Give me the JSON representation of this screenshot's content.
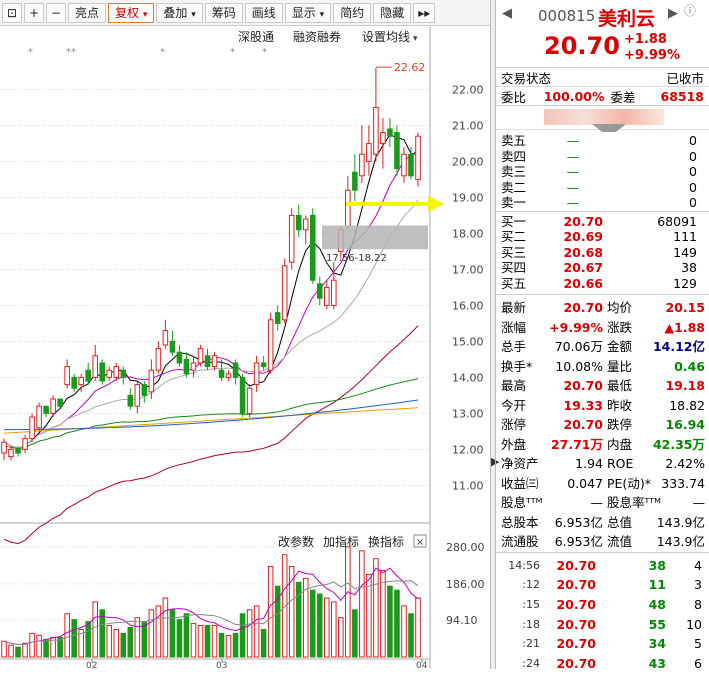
{
  "toolbar": {
    "buttons": [
      "亮点",
      "复权",
      "叠加",
      "筹码",
      "画线",
      "显示",
      "简约",
      "隐藏"
    ],
    "more": "▸▸"
  },
  "kline": {
    "indicators": [
      "深股通",
      "融资融券",
      "设置均线"
    ],
    "markers": [
      "*",
      "**",
      "*",
      "*",
      "*"
    ],
    "price_axis": [
      "22.00",
      "21.00",
      "20.00",
      "19.00",
      "18.00",
      "17.00",
      "16.00",
      "15.00",
      "14.00",
      "13.00",
      "12.00",
      "11.00"
    ],
    "max_label": "22.62",
    "gap_label": "17.56-18.22",
    "vol_menu": [
      "改参数",
      "加指标",
      "换指标"
    ],
    "vol_axis": [
      "280.00",
      "186.00",
      "94.10"
    ],
    "month_labels": [
      "02",
      "03",
      "04"
    ],
    "close_btn": "×"
  },
  "chart_data": {
    "type": "candlestick",
    "ylim": [
      10.4,
      22.9
    ],
    "candles": [
      {
        "o": 11.9,
        "c": 12.2,
        "h": 12.3,
        "l": 11.7,
        "v": 40
      },
      {
        "o": 11.8,
        "c": 12.0,
        "h": 12.1,
        "l": 11.7,
        "v": 30
      },
      {
        "o": 12.0,
        "c": 11.9,
        "h": 12.1,
        "l": 11.8,
        "v": 25
      },
      {
        "o": 12.0,
        "c": 12.3,
        "h": 12.4,
        "l": 11.9,
        "v": 35
      },
      {
        "o": 12.3,
        "c": 12.9,
        "h": 13.0,
        "l": 12.2,
        "v": 60
      },
      {
        "o": 12.6,
        "c": 13.2,
        "h": 13.3,
        "l": 12.5,
        "v": 55
      },
      {
        "o": 13.2,
        "c": 13.0,
        "h": 13.2,
        "l": 12.9,
        "v": 45
      },
      {
        "o": 13.0,
        "c": 13.4,
        "h": 13.5,
        "l": 12.9,
        "v": 50
      },
      {
        "o": 13.4,
        "c": 13.2,
        "h": 13.4,
        "l": 13.1,
        "v": 50
      },
      {
        "o": 13.8,
        "c": 14.3,
        "h": 14.5,
        "l": 13.7,
        "v": 110
      },
      {
        "o": 14.0,
        "c": 13.7,
        "h": 14.1,
        "l": 13.6,
        "v": 95
      },
      {
        "o": 13.8,
        "c": 14.0,
        "h": 14.1,
        "l": 13.6,
        "v": 70
      },
      {
        "o": 14.2,
        "c": 13.9,
        "h": 14.4,
        "l": 13.8,
        "v": 90
      },
      {
        "o": 14.0,
        "c": 14.6,
        "h": 14.9,
        "l": 13.9,
        "v": 140
      },
      {
        "o": 14.4,
        "c": 13.9,
        "h": 14.5,
        "l": 13.8,
        "v": 120
      },
      {
        "o": 14.0,
        "c": 14.2,
        "h": 14.3,
        "l": 13.9,
        "v": 80
      },
      {
        "o": 14.0,
        "c": 14.3,
        "h": 14.4,
        "l": 13.9,
        "v": 70
      },
      {
        "o": 14.2,
        "c": 14.0,
        "h": 14.3,
        "l": 13.8,
        "v": 60
      },
      {
        "o": 13.5,
        "c": 13.2,
        "h": 13.7,
        "l": 13.1,
        "v": 75
      },
      {
        "o": 13.2,
        "c": 13.8,
        "h": 13.9,
        "l": 13.0,
        "v": 100
      },
      {
        "o": 13.8,
        "c": 13.5,
        "h": 13.9,
        "l": 13.3,
        "v": 90
      },
      {
        "o": 13.6,
        "c": 14.2,
        "h": 14.5,
        "l": 13.4,
        "v": 120
      },
      {
        "o": 14.2,
        "c": 14.8,
        "h": 15.0,
        "l": 14.1,
        "v": 130
      },
      {
        "o": 14.9,
        "c": 15.3,
        "h": 15.6,
        "l": 14.8,
        "v": 150
      },
      {
        "o": 15.0,
        "c": 14.7,
        "h": 15.3,
        "l": 14.6,
        "v": 120
      },
      {
        "o": 14.7,
        "c": 14.4,
        "h": 14.9,
        "l": 14.3,
        "v": 95
      },
      {
        "o": 14.5,
        "c": 14.1,
        "h": 14.7,
        "l": 14.0,
        "v": 110
      },
      {
        "o": 14.2,
        "c": 14.4,
        "h": 14.6,
        "l": 14.0,
        "v": 85
      },
      {
        "o": 14.4,
        "c": 14.8,
        "h": 14.9,
        "l": 14.3,
        "v": 80
      },
      {
        "o": 14.6,
        "c": 14.3,
        "h": 14.8,
        "l": 14.2,
        "v": 80
      },
      {
        "o": 14.3,
        "c": 14.6,
        "h": 14.7,
        "l": 14.2,
        "v": 80
      },
      {
        "o": 14.2,
        "c": 14.0,
        "h": 14.5,
        "l": 13.9,
        "v": 60
      },
      {
        "o": 14.0,
        "c": 14.1,
        "h": 14.2,
        "l": 13.9,
        "v": 55
      },
      {
        "o": 14.4,
        "c": 14.0,
        "h": 14.5,
        "l": 13.8,
        "v": 60
      },
      {
        "o": 14.0,
        "c": 13.0,
        "h": 14.1,
        "l": 12.9,
        "v": 110
      },
      {
        "o": 13.0,
        "c": 13.7,
        "h": 13.8,
        "l": 12.9,
        "v": 120
      },
      {
        "o": 13.8,
        "c": 14.4,
        "h": 14.6,
        "l": 13.6,
        "v": 130
      },
      {
        "o": 14.4,
        "c": 14.3,
        "h": 14.6,
        "l": 14.2,
        "v": 70
      },
      {
        "o": 14.2,
        "c": 15.6,
        "h": 15.8,
        "l": 14.1,
        "v": 230
      },
      {
        "o": 15.8,
        "c": 15.5,
        "h": 16.0,
        "l": 15.3,
        "v": 180
      },
      {
        "o": 15.6,
        "c": 17.1,
        "h": 17.3,
        "l": 15.5,
        "v": 260
      },
      {
        "o": 17.2,
        "c": 18.5,
        "h": 18.7,
        "l": 17.0,
        "v": 230
      },
      {
        "o": 18.5,
        "c": 18.1,
        "h": 18.8,
        "l": 17.9,
        "v": 190
      },
      {
        "o": 18.1,
        "c": 18.4,
        "h": 18.5,
        "l": 17.7,
        "v": 200
      },
      {
        "o": 18.5,
        "c": 16.7,
        "h": 18.7,
        "l": 16.6,
        "v": 170
      },
      {
        "o": 16.6,
        "c": 16.2,
        "h": 16.8,
        "l": 16.0,
        "v": 160
      },
      {
        "o": 16.0,
        "c": 16.5,
        "h": 16.7,
        "l": 15.9,
        "v": 150
      },
      {
        "o": 16.0,
        "c": 16.7,
        "h": 17.2,
        "l": 15.9,
        "v": 140
      },
      {
        "o": 17.5,
        "c": 18.1,
        "h": 18.2,
        "l": 17.3,
        "v": 100
      },
      {
        "o": 18.2,
        "c": 19.2,
        "h": 19.6,
        "l": 18.1,
        "v": 280
      },
      {
        "o": 19.7,
        "c": 19.2,
        "h": 20.2,
        "l": 18.9,
        "v": 120
      },
      {
        "o": 19.6,
        "c": 20.2,
        "h": 21.0,
        "l": 19.4,
        "v": 270
      },
      {
        "o": 20.0,
        "c": 20.5,
        "h": 21.0,
        "l": 19.6,
        "v": 210
      },
      {
        "o": 20.2,
        "c": 21.5,
        "h": 22.6,
        "l": 20.0,
        "v": 250
      },
      {
        "o": 20.5,
        "c": 20.8,
        "h": 21.2,
        "l": 19.8,
        "v": 220
      },
      {
        "o": 20.9,
        "c": 20.7,
        "h": 21.2,
        "l": 20.4,
        "v": 180
      },
      {
        "o": 20.8,
        "c": 19.8,
        "h": 21.0,
        "l": 19.6,
        "v": 170
      },
      {
        "o": 19.6,
        "c": 20.2,
        "h": 20.4,
        "l": 19.4,
        "v": 130
      },
      {
        "o": 20.2,
        "c": 19.6,
        "h": 20.4,
        "l": 19.5,
        "v": 110
      },
      {
        "o": 19.5,
        "c": 20.7,
        "h": 20.8,
        "l": 19.3,
        "v": 150
      }
    ]
  },
  "quote": {
    "code": "000815",
    "name": "美利云",
    "price": "20.70",
    "change": "+1.88",
    "pct": "+9.99%",
    "info_icon": "ⓘ",
    "prev": "◀",
    "next": "▶"
  },
  "status": {
    "label": "交易状态",
    "value": "已收市"
  },
  "ratio": {
    "l1": "委比",
    "v1": "100.00%",
    "l2": "委差",
    "v2": "68518"
  },
  "sell": [
    {
      "label": "卖五",
      "price": "—",
      "vol": "0"
    },
    {
      "label": "卖四",
      "price": "—",
      "vol": "0"
    },
    {
      "label": "卖三",
      "price": "—",
      "vol": "0"
    },
    {
      "label": "卖二",
      "price": "—",
      "vol": "0"
    },
    {
      "label": "卖一",
      "price": "—",
      "vol": "0"
    }
  ],
  "buy": [
    {
      "label": "买一",
      "price": "20.70",
      "vol": "68091"
    },
    {
      "label": "买二",
      "price": "20.69",
      "vol": "111"
    },
    {
      "label": "买三",
      "price": "20.68",
      "vol": "149"
    },
    {
      "label": "买四",
      "price": "20.67",
      "vol": "38"
    },
    {
      "label": "买五",
      "price": "20.66",
      "vol": "129"
    }
  ],
  "stats": [
    {
      "a": "最新",
      "b": "20.70",
      "bc": "red",
      "c": "均价",
      "d": "20.15",
      "dc": "red"
    },
    {
      "a": "涨幅",
      "b": "+9.99%",
      "bc": "red",
      "c": "涨跌",
      "d": "▲1.88",
      "dc": "red"
    },
    {
      "a": "总手",
      "b": "70.06万",
      "bc": "",
      "c": "金额",
      "d": "14.12亿",
      "dc": "navy"
    },
    {
      "a": "换手*",
      "b": "10.08%",
      "bc": "",
      "c": "量比",
      "d": "0.46",
      "dc": "green"
    },
    {
      "a": "最高",
      "b": "20.70",
      "bc": "red",
      "c": "最低",
      "d": "19.18",
      "dc": "red"
    },
    {
      "a": "今开",
      "b": "19.33",
      "bc": "red",
      "c": "昨收",
      "d": "18.82",
      "dc": ""
    },
    {
      "a": "涨停",
      "b": "20.70",
      "bc": "red",
      "c": "跌停",
      "d": "16.94",
      "dc": "green"
    },
    {
      "a": "外盘",
      "b": "27.71万",
      "bc": "red",
      "c": "内盘",
      "d": "42.35万",
      "dc": "green"
    },
    {
      "a": "净资产",
      "b": "1.94",
      "bc": "",
      "c": "ROE",
      "d": "2.42%",
      "dc": ""
    },
    {
      "a": "收益㈢",
      "b": "0.047",
      "bc": "",
      "c": "PE(动)*",
      "d": "333.74",
      "dc": ""
    },
    {
      "a": "股息ᵀᵀᴹ",
      "b": "—",
      "bc": "",
      "c": "股息率ᵀᵀᴹ",
      "d": "—",
      "dc": ""
    },
    {
      "a": "总股本",
      "b": "6.953亿",
      "bc": "",
      "c": "总值",
      "d": "143.9亿",
      "dc": ""
    },
    {
      "a": "流通股",
      "b": "6.953亿",
      "bc": "",
      "c": "流值",
      "d": "143.9亿",
      "dc": ""
    }
  ],
  "ticks": [
    {
      "t": "14:56",
      "p": "20.70",
      "v": "38",
      "n": "4"
    },
    {
      "t": ":12",
      "p": "20.70",
      "v": "11",
      "n": "3"
    },
    {
      "t": ":15",
      "p": "20.70",
      "v": "48",
      "n": "8"
    },
    {
      "t": ":18",
      "p": "20.70",
      "v": "55",
      "n": "10"
    },
    {
      "t": ":21",
      "p": "20.70",
      "v": "34",
      "n": "5"
    },
    {
      "t": ":24",
      "p": "20.70",
      "v": "43",
      "n": "6"
    }
  ]
}
